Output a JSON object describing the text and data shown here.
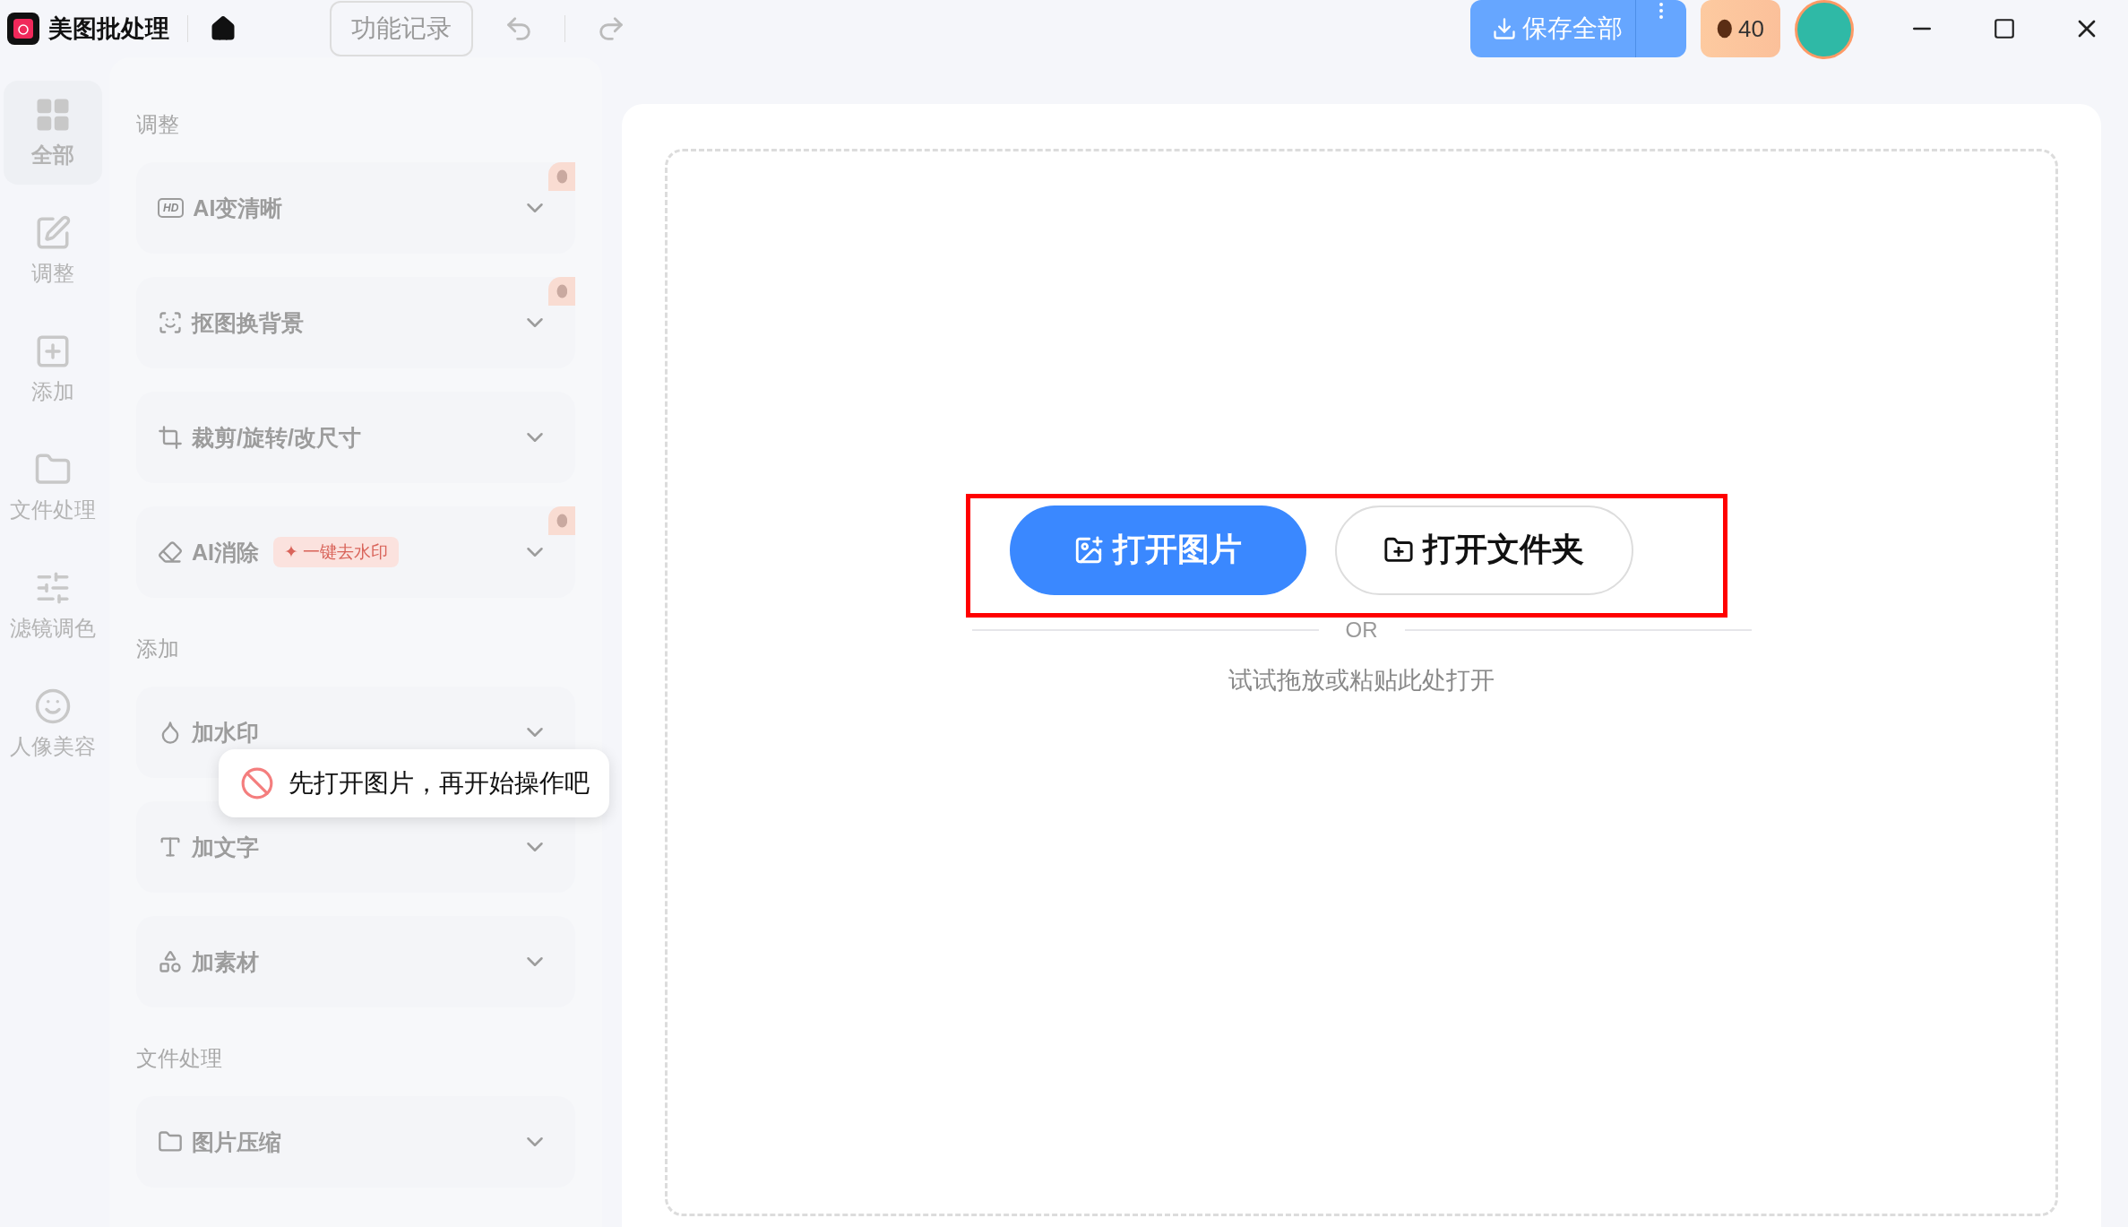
{
  "app": {
    "title": "美图批处理",
    "history_button": "功能记录",
    "save_button": "保存全部",
    "coins": "40"
  },
  "rail": [
    {
      "label": "全部",
      "selected": true
    },
    {
      "label": "调整",
      "selected": false
    },
    {
      "label": "添加",
      "selected": false
    },
    {
      "label": "文件处理",
      "selected": false
    },
    {
      "label": "滤镜调色",
      "selected": false
    },
    {
      "label": "人像美容",
      "selected": false
    }
  ],
  "tools_disabled": true,
  "sections": [
    {
      "title": "调整",
      "tools": [
        {
          "label": "AI变清晰",
          "paid": true,
          "icon_text": "HD"
        },
        {
          "label": "抠图换背景",
          "paid": true
        },
        {
          "label": "裁剪/旋转/改尺寸",
          "paid": false
        },
        {
          "label": "AI消除",
          "paid": true,
          "badge": "✦ 一键去水印"
        }
      ]
    },
    {
      "title": "添加",
      "tools": [
        {
          "label": "加水印",
          "paid": false
        },
        {
          "label": "加文字",
          "paid": false
        },
        {
          "label": "加素材",
          "paid": false
        }
      ]
    },
    {
      "title": "文件处理",
      "tools": [
        {
          "label": "图片压缩",
          "paid": false
        }
      ]
    }
  ],
  "tooltip": "先打开图片，再开始操作吧",
  "drop_zone": {
    "open_image": "打开图片",
    "open_folder": "打开文件夹",
    "divider": "OR",
    "hint": "试试拖放或粘贴此处打开"
  }
}
